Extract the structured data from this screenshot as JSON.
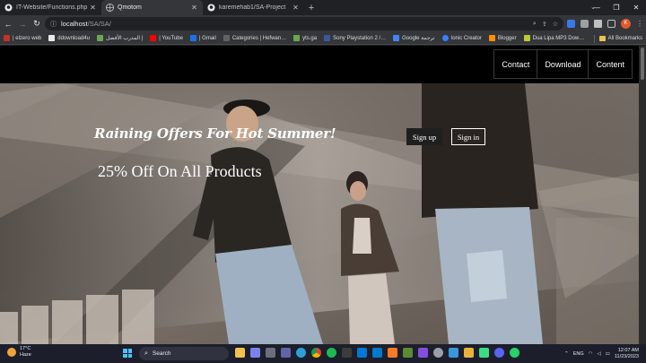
{
  "browser": {
    "tabs": [
      {
        "title": "IT-Website/Functions.php at main",
        "icon": "github-icon",
        "active": false
      },
      {
        "title": "Qmotom",
        "icon": "page-icon",
        "active": true
      },
      {
        "title": "karemehab1/SA-Project",
        "icon": "github-icon",
        "active": false
      }
    ],
    "url_host": "localhost",
    "url_path": "/SA/SA/",
    "profile_initial": "K",
    "bookmarks": [
      {
        "label": "| elzero web",
        "color": "#c4302b"
      },
      {
        "label": "ddownload4u",
        "color": "#e8eaed"
      },
      {
        "label": "المدرب الأفضل |",
        "color": "#6aa84f"
      },
      {
        "label": "| YouTube",
        "color": "#ff0000"
      },
      {
        "label": "| Gmail",
        "color": "#1a73e8"
      },
      {
        "label": "Categories | Hefwan…",
        "color": "#5f6368"
      },
      {
        "label": "yts.ga",
        "color": "#6aa84f"
      },
      {
        "label": "Sony Playstation 2 /…",
        "color": "#3b5998"
      },
      {
        "label": "Google ترجمة",
        "color": "#4285f4"
      },
      {
        "label": "Ionic Creator",
        "color": "#3880ff"
      },
      {
        "label": "Blogger",
        "color": "#ff8f00"
      },
      {
        "label": "Dua Lipa MP3 Dow…",
        "color": "#c0ca33"
      }
    ],
    "all_bookmarks": "All Bookmarks"
  },
  "site": {
    "nav": [
      "Contact",
      "Download",
      "Content"
    ],
    "hero_title": "Raining Offers For Hot Summer!",
    "hero_subtitle": "25% Off On All Products",
    "signup_label": "Sign up",
    "signin_label": "Sign in"
  },
  "taskbar": {
    "temperature": "17°C",
    "weather": "Haze",
    "search_placeholder": "Search",
    "language": "ENG",
    "time": "12:07 AM",
    "date": "11/23/2023",
    "apps": [
      {
        "name": "file-explorer-icon",
        "color": "#f2c14e"
      },
      {
        "name": "teams-icon",
        "color": "#7b83eb"
      },
      {
        "name": "widgets-icon",
        "color": "#3a3f4b"
      },
      {
        "name": "chat-icon",
        "color": "#6264a7"
      },
      {
        "name": "edge-icon",
        "color": "#2c9fd8"
      },
      {
        "name": "chrome-icon",
        "color": "#db4437"
      },
      {
        "name": "spotify-icon",
        "color": "#1db954"
      },
      {
        "name": "terminal-icon",
        "color": "#3c3c3c"
      },
      {
        "name": "store-icon",
        "color": "#0078d4"
      },
      {
        "name": "vscode-icon",
        "color": "#007acc"
      },
      {
        "name": "xampp-icon",
        "color": "#fb7a24"
      },
      {
        "name": "minecraft-icon",
        "color": "#5b8c32"
      },
      {
        "name": "github-desktop-icon",
        "color": "#8250df"
      },
      {
        "name": "settings-icon",
        "color": "#9aa0a6"
      },
      {
        "name": "photos-icon",
        "color": "#3a96dd"
      },
      {
        "name": "folder-icon",
        "color": "#e8b23a"
      },
      {
        "name": "android-studio-icon",
        "color": "#3ddc84"
      },
      {
        "name": "discord-icon",
        "color": "#5865f2"
      },
      {
        "name": "whatsapp-icon",
        "color": "#25d366"
      }
    ]
  }
}
